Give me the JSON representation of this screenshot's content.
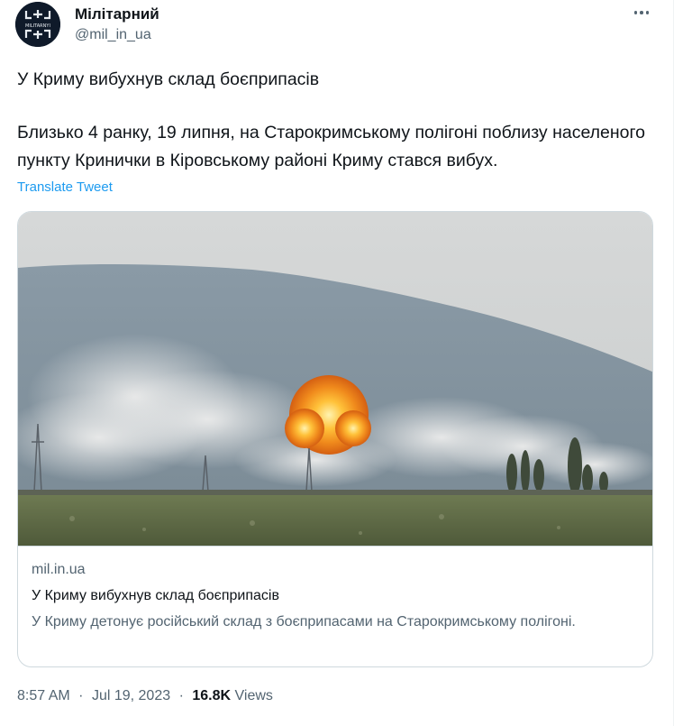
{
  "author": {
    "name": "Мілітарний",
    "handle": "@mil_in_ua",
    "avatar_text": "MILITARNYI"
  },
  "tweet": {
    "headline": "У Криму вибухнув склад боєприпасів",
    "body": "Близько 4 ранку, 19 липня, на Старокримському полігоні поблизу населеного пункту Кринички в Кіровському районі Криму стався вибух.",
    "translate_label": "Translate Tweet"
  },
  "card": {
    "image_icon": "explosion-photo",
    "domain": "mil.in.ua",
    "title": "У Криму вибухнув склад боєприпасів",
    "description": "У Криму детонує російський склад з боєприпасами на Старокримському полігоні."
  },
  "meta": {
    "time": "8:57 AM",
    "date": "Jul 19, 2023",
    "views_count": "16.8K",
    "views_label": "Views",
    "separator": "·"
  },
  "colors": {
    "link": "#1d9bf0",
    "secondary_text": "#536471",
    "border": "#cfd9de"
  }
}
